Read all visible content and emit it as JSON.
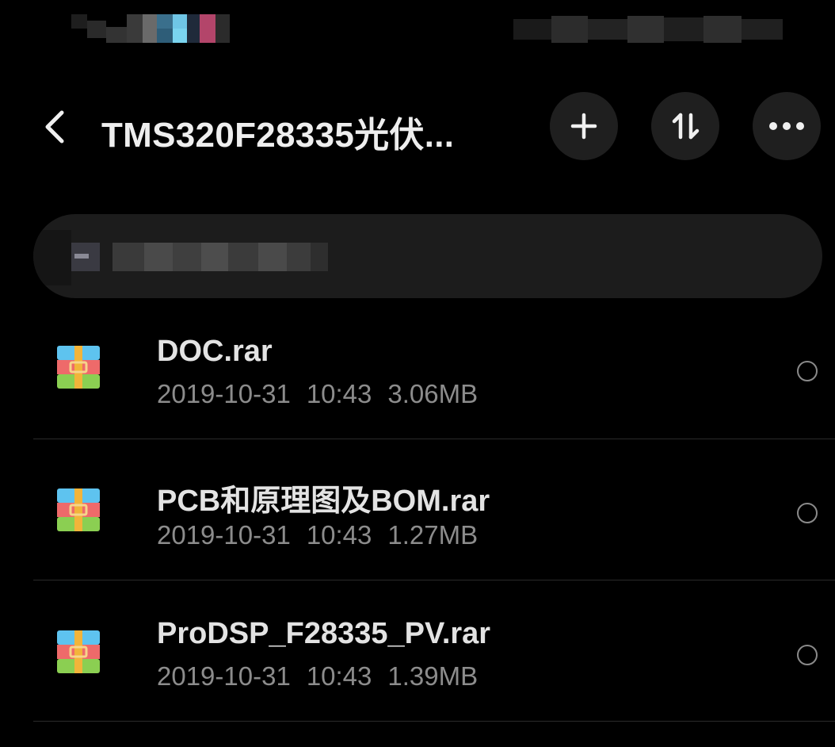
{
  "header": {
    "title": "TMS320F28335光伏..."
  },
  "icons": {
    "back": "chevron-left-icon",
    "add": "plus-icon",
    "sort": "sort-arrows-icon",
    "more": "more-horizontal-icon",
    "file": "archive-rar-icon",
    "select": "radio-circle-icon"
  },
  "colors": {
    "background": "#000000",
    "button_bg": "#1f1f1f",
    "path_bar_bg": "#1c1c1c",
    "file_name": "#e3e3e3",
    "file_meta": "#8c8c8c",
    "divider": "#2a2a2a"
  },
  "files": [
    {
      "name": "DOC.rar",
      "date": "2019-10-31",
      "time": "10:43",
      "size": "3.06MB"
    },
    {
      "name": "PCB和原理图及BOM.rar",
      "date": "2019-10-31",
      "time": "10:43",
      "size": "1.27MB"
    },
    {
      "name": "ProDSP_F28335_PV.rar",
      "date": "2019-10-31",
      "time": "10:43",
      "size": "1.39MB"
    }
  ]
}
